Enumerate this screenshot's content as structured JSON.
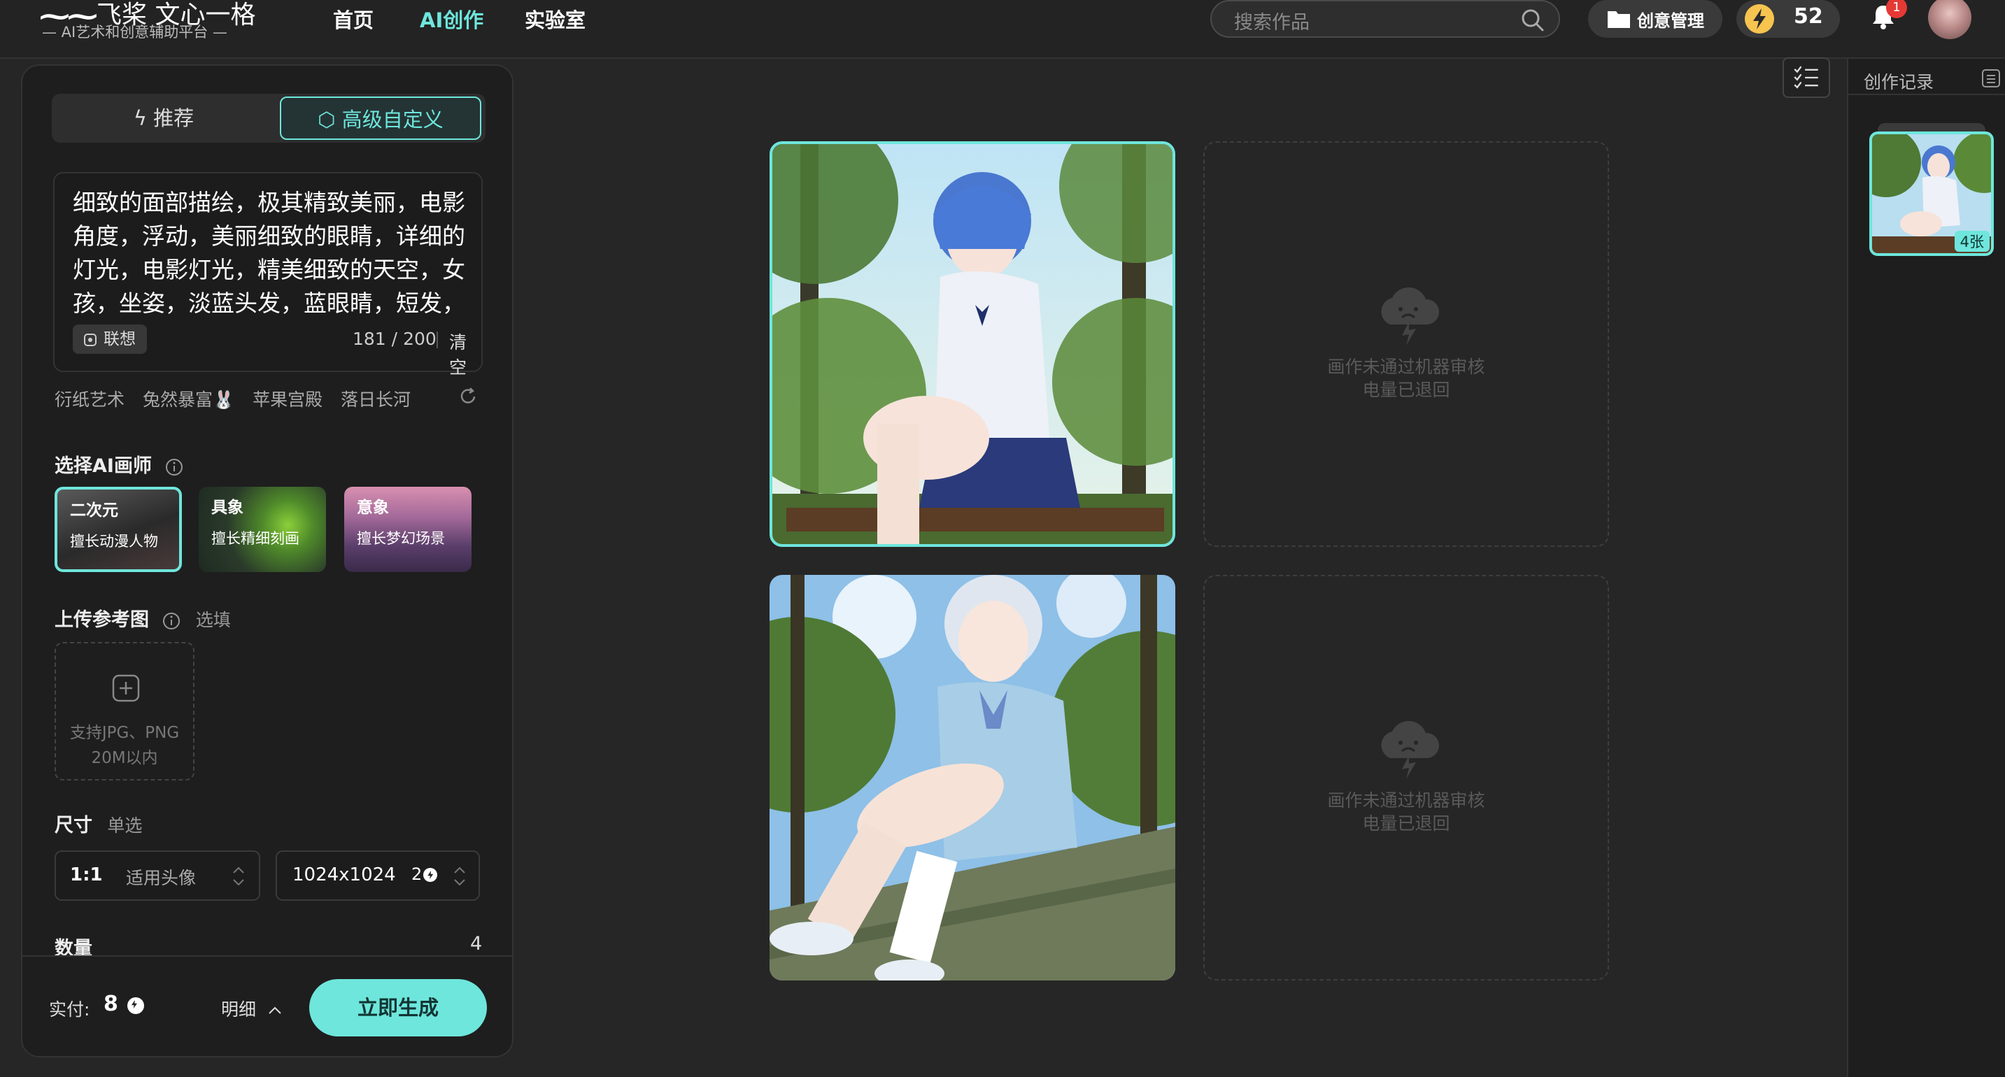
{
  "header": {
    "logo_mark": "⁓⁓",
    "logo_title": "飞桨 文心一格",
    "logo_subtitle": "— AI艺术和创意辅助平台 —",
    "nav": [
      {
        "label": "首页",
        "active": false
      },
      {
        "label": "AI创作",
        "active": true
      },
      {
        "label": "实验室",
        "active": false
      }
    ],
    "search_placeholder": "搜索作品",
    "creative_mgmt": "创意管理",
    "points": "52",
    "notification_count": "1"
  },
  "panel": {
    "tabs": [
      {
        "label": "推荐",
        "icon": "bolt-icon"
      },
      {
        "label": "高级自定义",
        "icon": "cube-icon",
        "active": true
      }
    ],
    "prompt": "细致的面部描绘，极其精致美丽，电影角度，浮动，美丽细致的眼睛，详细的灯光，电影灯光，精美细致的天空，女孩，坐姿，淡蓝头发，蓝眼睛，短发，",
    "associate_label": "联想",
    "char_count": "181",
    "char_max": "200",
    "char_sep": "/",
    "clear_label": "清空",
    "tags": [
      "衍纸艺术",
      "兔然暴富🐰",
      "苹果宫殿",
      "落日长河"
    ],
    "artist_section": "选择AI画师",
    "artists": [
      {
        "name": "二次元",
        "desc": "擅长动漫人物",
        "selected": true
      },
      {
        "name": "具象",
        "desc": "擅长精细刻画",
        "selected": false
      },
      {
        "name": "意象",
        "desc": "擅长梦幻场景",
        "selected": false
      }
    ],
    "upload_section": "上传参考图",
    "upload_hint": "选填",
    "upload_text_1": "支持JPG、PNG",
    "upload_text_2": "20M以内",
    "size_section": "尺寸",
    "size_hint": "单选",
    "ratio_value": "1:1",
    "ratio_hint": "适用头像",
    "resolution": "1024x1024",
    "resolution_cost": "2",
    "quantity_label": "数量",
    "quantity_value": "4",
    "pay_label": "实付:",
    "pay_value": "8",
    "detail_label": "明细",
    "generate_button": "立即生成"
  },
  "results": {
    "fail_line_1": "画作未通过机器审核",
    "fail_line_2": "电量已退回"
  },
  "history": {
    "title": "创作记录",
    "thumb_count": "4张"
  },
  "colors": {
    "accent": "#6ee6dc",
    "background": "#262626",
    "panel": "#1e1e1e"
  }
}
